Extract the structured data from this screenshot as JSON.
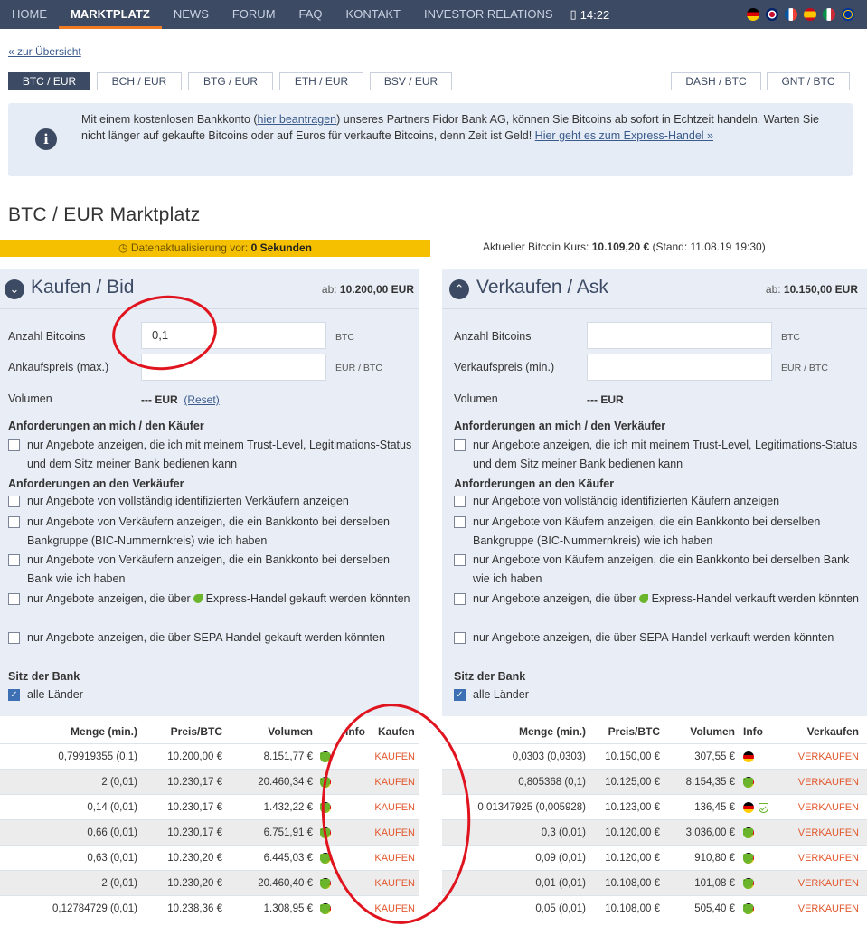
{
  "nav": {
    "items": [
      "HOME",
      "MARKTPLATZ",
      "NEWS",
      "FORUM",
      "FAQ",
      "KONTAKT",
      "INVESTOR RELATIONS"
    ],
    "active": "MARKTPLATZ",
    "clock": "14:22",
    "flags": [
      "de",
      "uk",
      "fr",
      "es",
      "it",
      "eu"
    ]
  },
  "back_link": "« zur Übersicht",
  "pair_tabs": [
    "BTC / EUR",
    "BCH / EUR",
    "BTG / EUR",
    "ETH / EUR",
    "BSV / EUR",
    "DASH / BTC",
    "GNT / BTC"
  ],
  "info": {
    "t1": "Mit einem kostenlosen Bankkonto (",
    "link1": "hier beantragen",
    "t2": ") unseres Partners Fidor Bank AG, können Sie Bitcoins ab sofort in Echtzeit handeln. Warten Sie nicht länger auf gekaufte Bitcoins oder auf Euros für verkaufte Bitcoins, denn Zeit ist Geld! ",
    "link2": "Hier geht es zum Express-Handel »"
  },
  "page_title": "BTC / EUR Marktplatz",
  "update": {
    "label": "Datenaktualisierung vor:",
    "value": "0 Sekunden"
  },
  "price": {
    "label": "Aktueller Bitcoin Kurs:",
    "value": "10.109,20 €",
    "stand": "(Stand: 11.08.19 19:30)"
  },
  "buy": {
    "title": "Kaufen / Bid",
    "from_label": "ab:",
    "from_value": "10.200,00",
    "from_unit": "EUR",
    "amount_label": "Anzahl Bitcoins",
    "amount_value": "0,1",
    "amount_unit": "BTC",
    "price_label": "Ankaufspreis (max.)",
    "price_unit": "EUR / BTC",
    "volume_label": "Volumen",
    "volume_value": "--- EUR",
    "reset": "(Reset)",
    "req_me": "Anforderungen an mich / den Käufer",
    "req_me_cb": "nur Angebote anzeigen, die ich mit meinem Trust-Level, Legitimations-Status und dem Sitz meiner Bank bedienen kann",
    "req_other": "Anforderungen an den Verkäufer",
    "cb1": "nur Angebote von vollständig identifizierten Verkäufern anzeigen",
    "cb2": "nur Angebote von Verkäufern anzeigen, die ein Bankkonto bei derselben Bankgruppe (BIC-Nummernkreis) wie ich haben",
    "cb3": "nur Angebote von Verkäufern anzeigen, die ein Bankkonto bei derselben Bank wie ich haben",
    "cb4a": "nur Angebote anzeigen, die über",
    "cb4b": "Express-Handel gekauft werden könnten",
    "cb5": "nur Angebote anzeigen, die über SEPA Handel gekauft werden könnten",
    "bank_seat": "Sitz der Bank",
    "all_countries": "alle Länder"
  },
  "sell": {
    "title": "Verkaufen / Ask",
    "from_label": "ab:",
    "from_value": "10.150,00",
    "from_unit": "EUR",
    "amount_label": "Anzahl Bitcoins",
    "amount_unit": "BTC",
    "price_label": "Verkaufspreis (min.)",
    "price_unit": "EUR / BTC",
    "volume_label": "Volumen",
    "volume_value": "--- EUR",
    "req_me": "Anforderungen an mich / den Verkäufer",
    "req_me_cb": "nur Angebote anzeigen, die ich mit meinem Trust-Level, Legitimations-Status und dem Sitz meiner Bank bedienen kann",
    "req_other": "Anforderungen an den Käufer",
    "cb1": "nur Angebote von vollständig identifizierten Käufern anzeigen",
    "cb2": "nur Angebote von Käufern anzeigen, die ein Bankkonto bei derselben Bankgruppe (BIC-Nummernkreis) wie ich haben",
    "cb3": "nur Angebote von Käufern anzeigen, die ein Bankkonto bei derselben Bank wie ich haben",
    "cb4a": "nur Angebote anzeigen, die über",
    "cb4b": "Express-Handel verkauft werden könnten",
    "cb5": "nur Angebote anzeigen, die über SEPA Handel verkauft werden könnten",
    "bank_seat": "Sitz der Bank",
    "all_countries": "alle Länder"
  },
  "buy_table": {
    "headers": [
      "Menge (min.)",
      "Preis/BTC",
      "Volumen",
      "Info",
      "Kaufen"
    ],
    "action": "KAUFEN",
    "rows": [
      [
        "0,79919355 (0,1)",
        "10.200,00 €",
        "8.151,77 €"
      ],
      [
        "2 (0,01)",
        "10.230,17 €",
        "20.460,34 €"
      ],
      [
        "0,14 (0,01)",
        "10.230,17 €",
        "1.432,22 €"
      ],
      [
        "0,66 (0,01)",
        "10.230,17 €",
        "6.751,91 €"
      ],
      [
        "0,63 (0,01)",
        "10.230,20 €",
        "6.445,03 €"
      ],
      [
        "2 (0,01)",
        "10.230,20 €",
        "20.460,40 €"
      ],
      [
        "0,12784729 (0,01)",
        "10.238,36 €",
        "1.308,95 €"
      ]
    ]
  },
  "sell_table": {
    "headers": [
      "Menge (min.)",
      "Preis/BTC",
      "Volumen",
      "Info",
      "Verkaufen"
    ],
    "action": "VERKAUFEN",
    "rows": [
      [
        "0,0303 (0,0303)",
        "10.150,00 €",
        "307,55 €"
      ],
      [
        "0,805368 (0,1)",
        "10.125,00 €",
        "8.154,35 €"
      ],
      [
        "0,01347925 (0,005928)",
        "10.123,00 €",
        "136,45 €"
      ],
      [
        "0,3 (0,01)",
        "10.120,00 €",
        "3.036,00 €"
      ],
      [
        "0,09 (0,01)",
        "10.120,00 €",
        "910,80 €"
      ],
      [
        "0,01 (0,01)",
        "10.108,00 €",
        "101,08 €"
      ],
      [
        "0,05 (0,01)",
        "10.108,00 €",
        "505,40 €"
      ]
    ]
  },
  "colors": {
    "nav_bg": "#3c4a63",
    "accent": "#ef7b22",
    "panel_bg": "#e9eef6",
    "update_bar": "#f5c000",
    "action": "#e2592f",
    "annotation": "#e0141e"
  }
}
